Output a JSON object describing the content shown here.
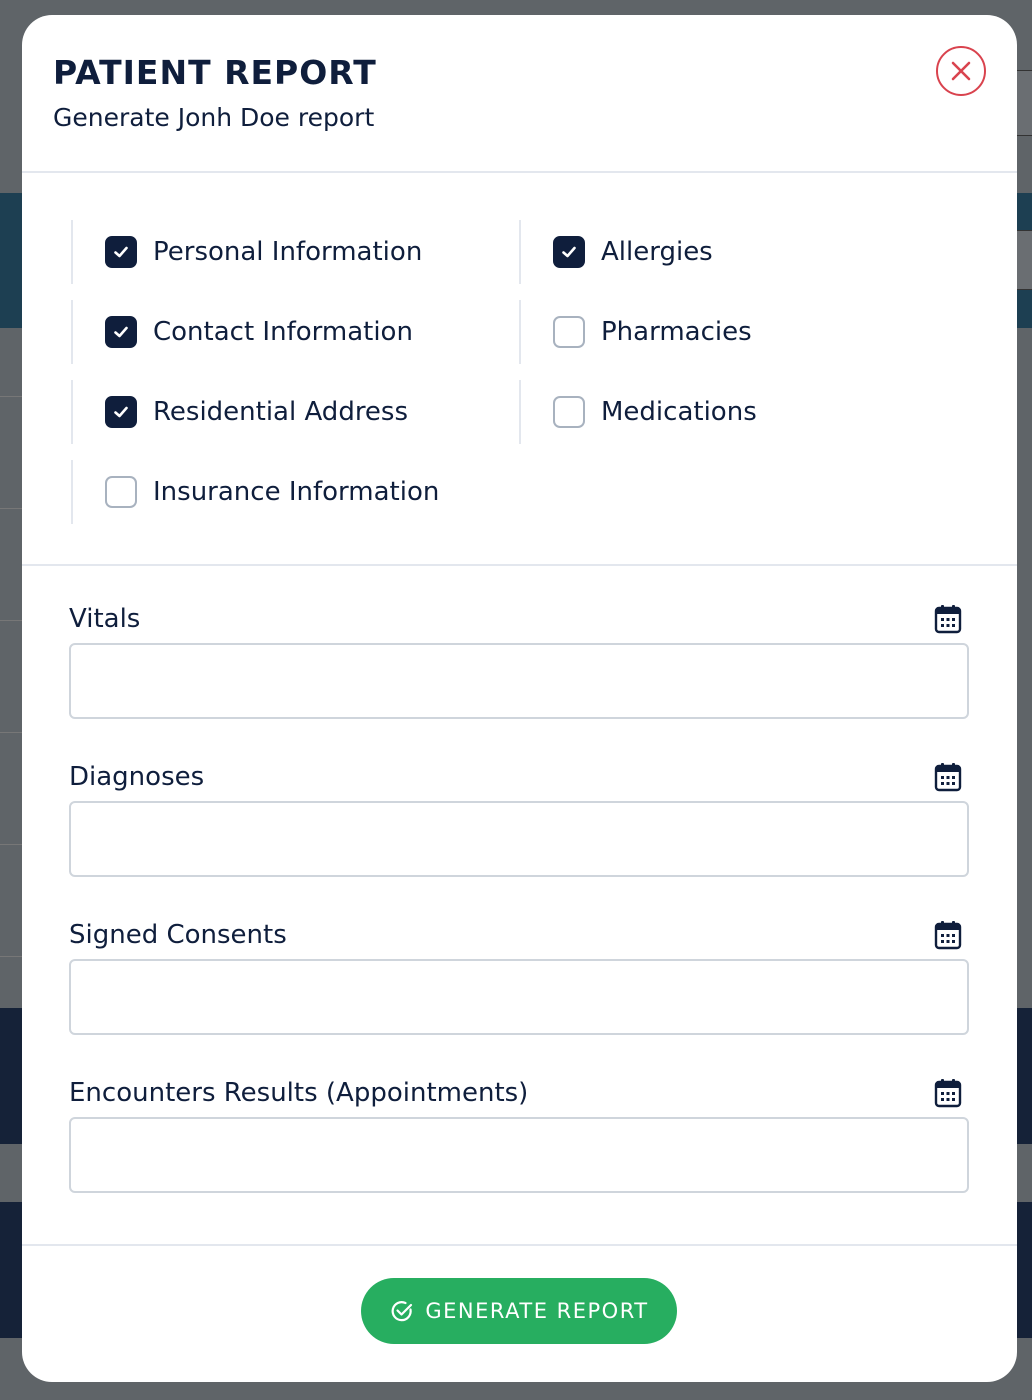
{
  "modal": {
    "title": "PATIENT REPORT",
    "subtitle": "Generate Jonh Doe report"
  },
  "sections": {
    "left": [
      {
        "label": "Personal Information",
        "checked": true
      },
      {
        "label": "Contact Information",
        "checked": true
      },
      {
        "label": "Residential Address",
        "checked": true
      },
      {
        "label": "Insurance Information",
        "checked": false
      }
    ],
    "right": [
      {
        "label": "Allergies",
        "checked": true
      },
      {
        "label": "Pharmacies",
        "checked": false
      },
      {
        "label": "Medications",
        "checked": false
      }
    ]
  },
  "date_fields": [
    {
      "label": "Vitals",
      "value": ""
    },
    {
      "label": "Diagnoses",
      "value": ""
    },
    {
      "label": "Signed Consents",
      "value": ""
    },
    {
      "label": "Encounters Results (Appointments)",
      "value": ""
    }
  ],
  "footer": {
    "generate_label": "GENERATE REPORT"
  },
  "icons": {
    "close": "close-circle-icon",
    "calendar": "calendar-icon",
    "check": "checkmark-icon",
    "generate": "check-circle-icon"
  },
  "colors": {
    "primary": "#0f1e3c",
    "success": "#27ae60",
    "danger": "#d9434e",
    "border": "#cfd5dc"
  }
}
